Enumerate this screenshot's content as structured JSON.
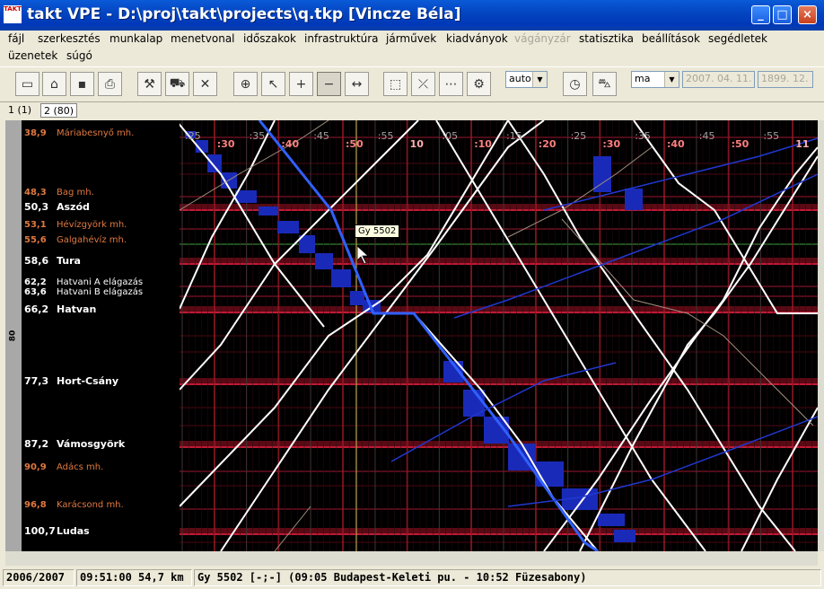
{
  "window": {
    "title": "takt VPE - D:\\proj\\takt\\projects\\q.tkp [Vincze Béla]",
    "app_icon": "TAKT",
    "minimize": "_",
    "maximize": "□",
    "close": "×"
  },
  "menu": [
    {
      "label": "fájl",
      "enabled": true
    },
    {
      "label": "szerkesztés",
      "enabled": true
    },
    {
      "label": "munkalap",
      "enabled": true
    },
    {
      "label": "menetvonal",
      "enabled": true
    },
    {
      "label": "időszakok",
      "enabled": true
    },
    {
      "label": "infrastruktúra",
      "enabled": true
    },
    {
      "label": "járművek",
      "enabled": true
    },
    {
      "label": "kiadványok",
      "enabled": true
    },
    {
      "label": "vágányzár",
      "enabled": false
    },
    {
      "label": "statisztika",
      "enabled": true
    },
    {
      "label": "beállítások",
      "enabled": true
    },
    {
      "label": "segédletek",
      "enabled": true
    },
    {
      "label": "üzenetek",
      "enabled": true
    },
    {
      "label": "súgó",
      "enabled": true
    }
  ],
  "toolbar": {
    "buttons": [
      "new-icon",
      "open-icon",
      "save-icon",
      "print-icon",
      "worker-icon",
      "train-icon",
      "delete-train-icon",
      "crosshair-icon",
      "pointer-plus-icon",
      "zoom-in-icon",
      "zoom-out-icon",
      "fit-width-icon",
      "select-rect-icon",
      "connect-icon",
      "numbered-select-icon",
      "train-tool-icon",
      "clock-icon",
      "cart-icon"
    ],
    "zoom_select": "auto",
    "day_select": "ma",
    "date_from": "2007. 04. 11.",
    "date_to": "1899. 12."
  },
  "tabs": [
    "1 (1)",
    "2 (80)"
  ],
  "graph": {
    "left_strip_label": "80",
    "stations": [
      {
        "km": "38,9",
        "name": "Máriabesnyő mh.",
        "kind": "minor"
      },
      {
        "km": "48,3",
        "name": "Bag mh.",
        "kind": "minor"
      },
      {
        "km": "50,3",
        "name": "Aszód",
        "kind": "major"
      },
      {
        "km": "53,1",
        "name": "Hévízgyörk mh.",
        "kind": "minor"
      },
      {
        "km": "55,6",
        "name": "Galgahévíz mh.",
        "kind": "minor"
      },
      {
        "km": "58,6",
        "name": "Tura",
        "kind": "major"
      },
      {
        "km": "62,2",
        "name": "Hatvani A elágazás",
        "kind": "junction"
      },
      {
        "km": "63,6",
        "name": "Hatvani B elágazás",
        "kind": "junction"
      },
      {
        "km": "66,2",
        "name": "Hatvan",
        "kind": "major"
      },
      {
        "km": "77,3",
        "name": "Hort-Csány",
        "kind": "major"
      },
      {
        "km": "87,2",
        "name": "Vámosgyörk",
        "kind": "major"
      },
      {
        "km": "90,9",
        "name": "Adács mh.",
        "kind": "minor"
      },
      {
        "km": "96,8",
        "name": "Karácsond mh.",
        "kind": "minor"
      },
      {
        "km": "100,7",
        "name": "Ludas",
        "kind": "major"
      }
    ],
    "time_ticks": [
      {
        "label": ":25",
        "kind": "five"
      },
      {
        "label": ":30",
        "kind": "ten"
      },
      {
        "label": ":35",
        "kind": "five"
      },
      {
        "label": ":40",
        "kind": "ten"
      },
      {
        "label": ":45",
        "kind": "five"
      },
      {
        "label": ":50",
        "kind": "ten"
      },
      {
        "label": ":55",
        "kind": "five"
      },
      {
        "label": "10",
        "kind": "hour"
      },
      {
        "label": ":05",
        "kind": "five"
      },
      {
        "label": ":10",
        "kind": "ten"
      },
      {
        "label": ":15",
        "kind": "five"
      },
      {
        "label": ":20",
        "kind": "ten"
      },
      {
        "label": ":25",
        "kind": "five"
      },
      {
        "label": ":30",
        "kind": "ten"
      },
      {
        "label": ":35",
        "kind": "five"
      },
      {
        "label": ":40",
        "kind": "ten"
      },
      {
        "label": ":45",
        "kind": "five"
      },
      {
        "label": ":50",
        "kind": "ten"
      },
      {
        "label": ":55",
        "kind": "five"
      },
      {
        "label": "11",
        "kind": "hour"
      }
    ],
    "tooltip": "Gy 5502"
  },
  "status": {
    "period": "2006/2007",
    "position": "09:51:00 54,7 km",
    "train": "Gy 5502  [-;-] (09:05 Budapest-Keleti pu. - 10:52 Füzesabony)"
  }
}
